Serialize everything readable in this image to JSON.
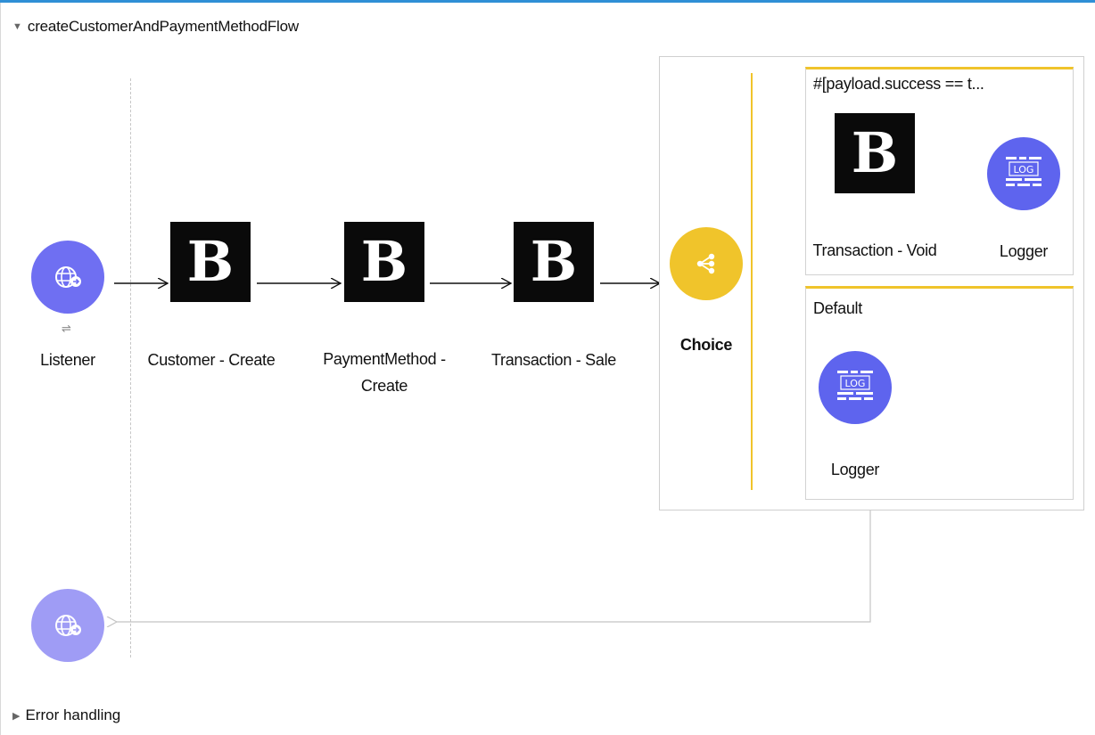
{
  "flow": {
    "title": "createCustomerAndPaymentMethodFlow",
    "expanded": true
  },
  "error_handling": {
    "title": "Error handling",
    "expanded": false
  },
  "nodes": {
    "listener": {
      "label": "Listener",
      "icon": "http-globe-icon",
      "color": "#6f6ff2"
    },
    "customer_create": {
      "label": "Customer - Create",
      "icon": "braintree-b-icon",
      "glyph": "B"
    },
    "payment_method_create": {
      "label": "PaymentMethod - Create",
      "icon": "braintree-b-icon",
      "glyph": "B"
    },
    "transaction_sale": {
      "label": "Transaction - Sale",
      "icon": "braintree-b-icon",
      "glyph": "B"
    },
    "choice": {
      "label": "Choice",
      "icon": "choice-router-icon",
      "color": "#f0c42b"
    },
    "response": {
      "icon": "http-globe-icon",
      "color": "#9f9cf5"
    }
  },
  "choice_routes": [
    {
      "title": "#[payload.success == t...",
      "nodes": [
        {
          "label": "Transaction - Void",
          "icon": "braintree-b-icon",
          "glyph": "B"
        },
        {
          "label": "Logger",
          "icon": "logger-icon"
        }
      ]
    },
    {
      "title": "Default",
      "nodes": [
        {
          "label": "Logger",
          "icon": "logger-icon"
        }
      ]
    }
  ],
  "theme": {
    "accent": "#2f8fd6",
    "listener": "#6f6ff2",
    "logger": "#5e64ee",
    "choice": "#f0c42b",
    "connector": "#0a0a0a"
  }
}
